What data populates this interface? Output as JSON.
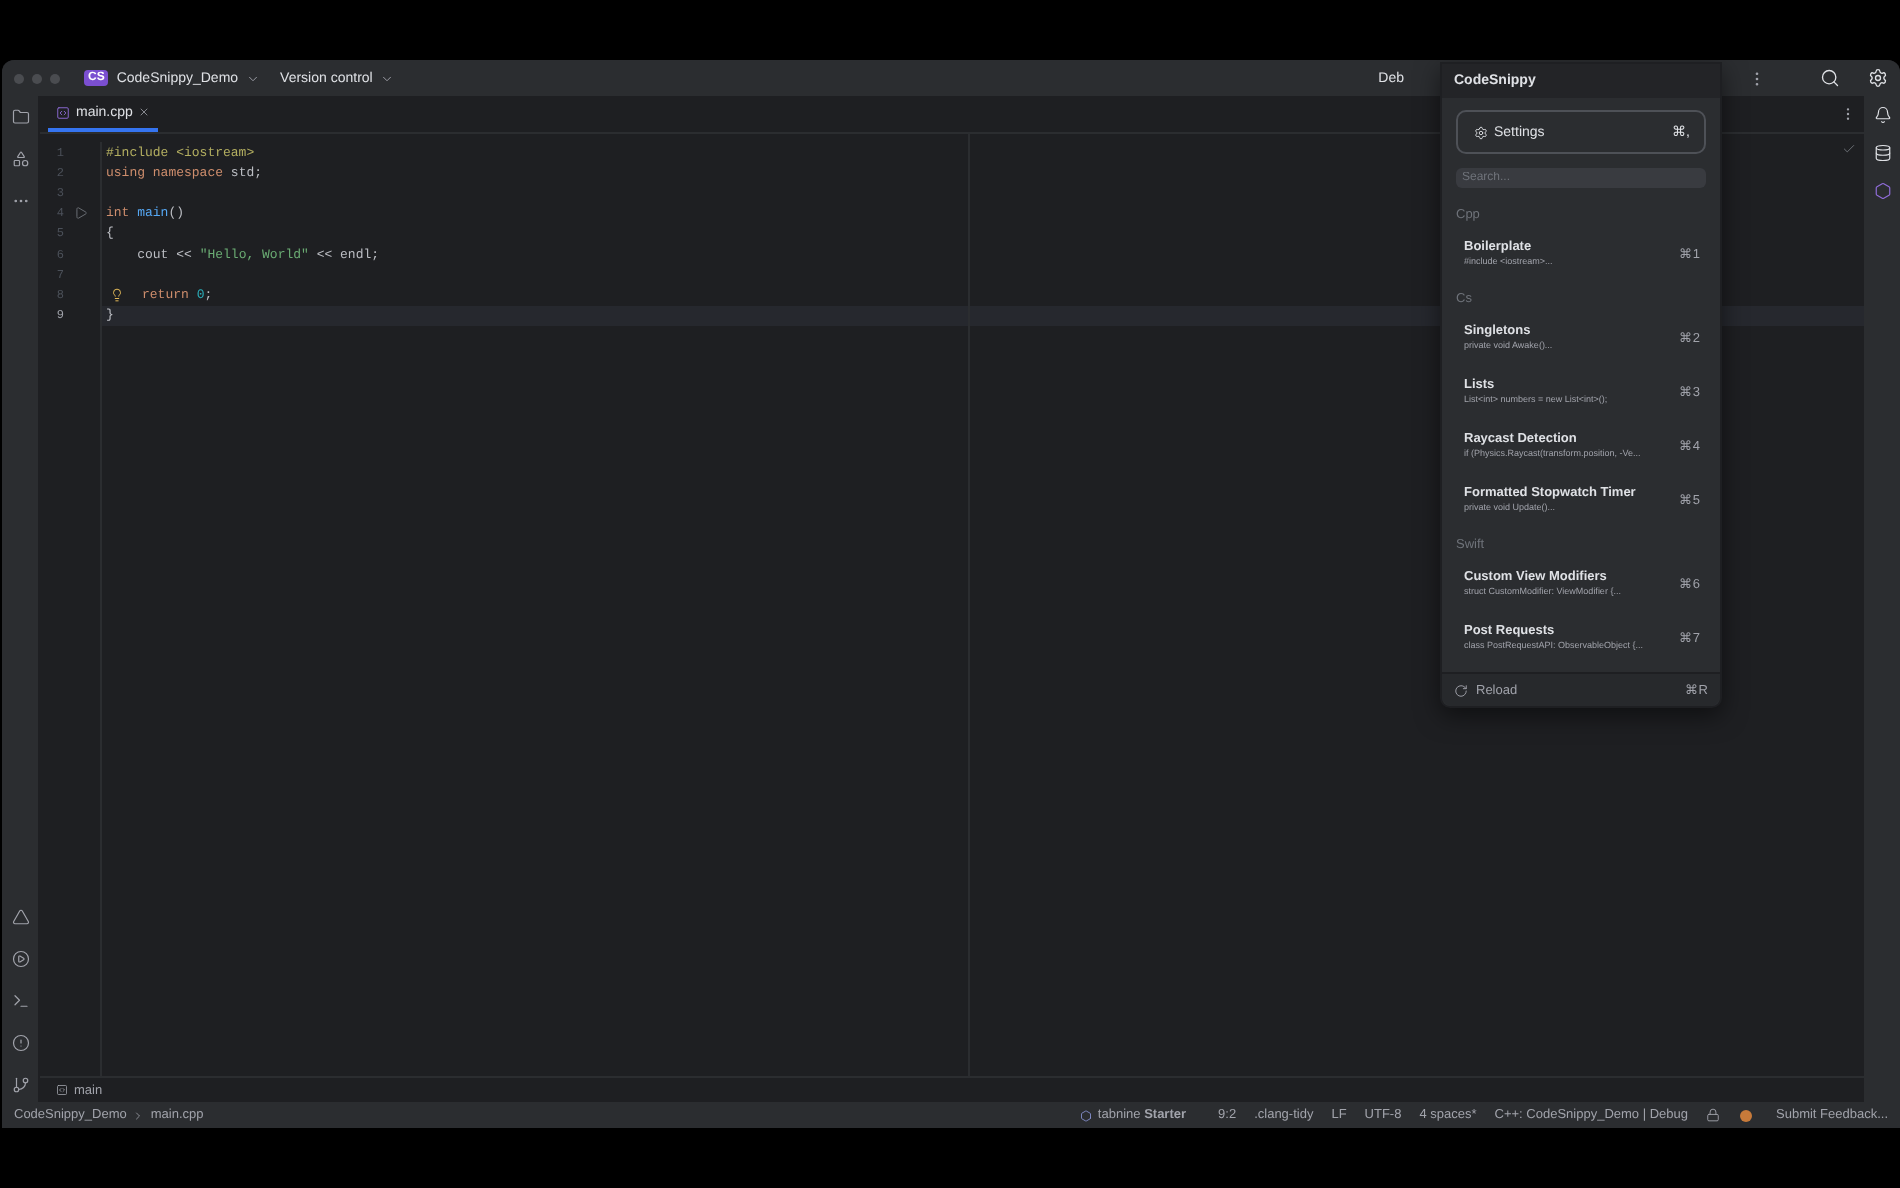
{
  "titlebar": {
    "project_badge": "CS",
    "project": "CodeSnippy_Demo",
    "vcs": "Version control",
    "run_config": "Deb"
  },
  "tabs": [
    {
      "label": "main.cpp",
      "selected": true
    }
  ],
  "editor": {
    "lines": [
      {
        "number": "1",
        "current": false,
        "run_button": false,
        "hint": false,
        "tokens": [
          {
            "text": "#include <iostream>",
            "kind": "preprocessor"
          }
        ]
      },
      {
        "number": "2",
        "current": false,
        "run_button": false,
        "hint": false,
        "tokens": [
          {
            "text": "using namespace ",
            "kind": "keyword"
          },
          {
            "text": "std;",
            "kind": "plain"
          }
        ]
      },
      {
        "number": "3",
        "current": false,
        "run_button": false,
        "hint": false
      },
      {
        "number": "4",
        "current": false,
        "run_button": true,
        "hint": false,
        "tokens": [
          {
            "text": "int ",
            "kind": "keyword"
          },
          {
            "text": "main",
            "kind": "function"
          },
          {
            "text": "()",
            "kind": "plain"
          }
        ]
      },
      {
        "number": "5",
        "current": false,
        "run_button": false,
        "hint": false,
        "tokens": [
          {
            "text": "{",
            "kind": "plain"
          }
        ]
      },
      {
        "number": "6",
        "current": false,
        "run_button": false,
        "hint": false,
        "tokens": [
          {
            "text": "    cout << ",
            "kind": "plain"
          },
          {
            "text": "\"Hello, World\"",
            "kind": "string"
          },
          {
            "text": " << endl;",
            "kind": "plain"
          }
        ]
      },
      {
        "number": "7",
        "current": false,
        "run_button": false,
        "hint": false
      },
      {
        "number": "8",
        "current": false,
        "run_button": false,
        "hint": true,
        "tokens": [
          {
            "text": "return ",
            "kind": "keyword"
          },
          {
            "text": "0",
            "kind": "number"
          },
          {
            "text": ";",
            "kind": "plain"
          }
        ]
      },
      {
        "number": "9",
        "current": true,
        "run_button": false,
        "hint": false,
        "tokens": [
          {
            "text": "}",
            "kind": "plain"
          }
        ]
      }
    ],
    "scope": "main"
  },
  "breadcrumb": [
    "CodeSnippy_Demo",
    "main.cpp"
  ],
  "status_bar": {
    "plugin": "tabnine **Starter**",
    "items": [
      "9:2",
      ".clang-tidy",
      "LF",
      "UTF-8",
      "4 spaces*",
      "C++: CodeSnippy_Demo | Debug"
    ],
    "feedback": "Submit Feedback..."
  },
  "popup": {
    "title": "CodeSnippy",
    "settings": {
      "label": "Settings",
      "shortcut": "⌘,"
    },
    "search": {
      "placeholder": "Search..."
    },
    "groups": [
      {
        "name": "Cpp",
        "snippets": [
          {
            "title": "Boilerplate",
            "preview": "#include <iostream>...",
            "shortcut": "⌘1"
          }
        ]
      },
      {
        "name": "Cs",
        "snippets": [
          {
            "title": "Singletons",
            "preview": "private void Awake()...",
            "shortcut": "⌘2"
          },
          {
            "title": "Lists",
            "preview": "List<int> numbers = new List<int>();",
            "shortcut": "⌘3"
          },
          {
            "title": "Raycast Detection",
            "preview": "if (Physics.Raycast(transform.position, -Ve...",
            "shortcut": "⌘4"
          },
          {
            "title": "Formatted Stopwatch Timer",
            "preview": "private void Update()...",
            "shortcut": "⌘5"
          }
        ]
      },
      {
        "name": "Swift",
        "snippets": [
          {
            "title": "Custom View Modifiers",
            "preview": "struct CustomModifier: ViewModifier {...",
            "shortcut": "⌘6"
          },
          {
            "title": "Post Requests",
            "preview": "class PostRequestAPI: ObservableObject {...",
            "shortcut": "⌘7"
          }
        ]
      }
    ],
    "reload": {
      "label": "Reload",
      "shortcut": "⌘R"
    }
  }
}
